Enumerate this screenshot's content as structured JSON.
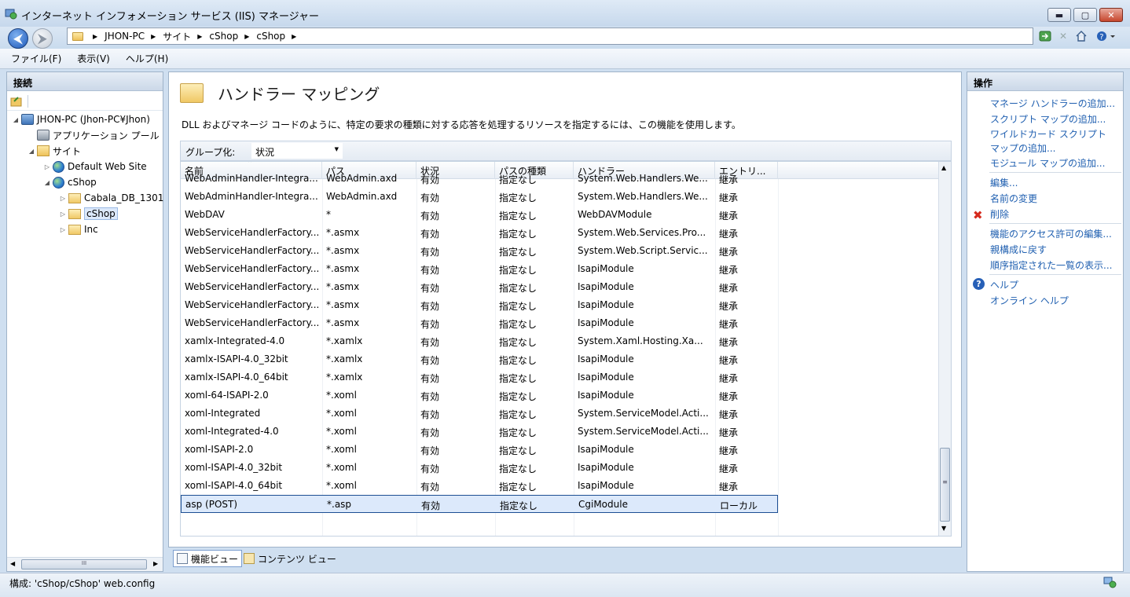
{
  "window": {
    "title": "インターネット インフォメーション サービス (IIS) マネージャー",
    "minimize": "▬",
    "maximize": "▢",
    "close": "✕"
  },
  "address": {
    "breadcrumbs": [
      "JHON-PC",
      "サイト",
      "cShop",
      "cShop"
    ],
    "sep": "▶"
  },
  "menu": [
    "ファイル(F)",
    "表示(V)",
    "ヘルプ(H)"
  ],
  "connections": {
    "title": "接続",
    "tree": [
      {
        "label": "JHON-PC (Jhon-PC¥Jhon)",
        "exp": "◢",
        "icon": "server-icon"
      },
      {
        "label": "アプリケーション プール",
        "exp": "",
        "icon": "app-pool-icon"
      },
      {
        "label": "サイト",
        "exp": "◢",
        "icon": "sites-folder-icon"
      },
      {
        "label": "Default Web Site",
        "exp": "▷",
        "icon": "globe-icon"
      },
      {
        "label": "cShop",
        "exp": "◢",
        "icon": "globe-icon"
      },
      {
        "label": "Cabala_DB_1301",
        "exp": "▷",
        "icon": "folder-icon"
      },
      {
        "label": "cShop",
        "exp": "▷",
        "icon": "folder-icon"
      },
      {
        "label": "Inc",
        "exp": "▷",
        "icon": "folder-icon"
      }
    ],
    "scroll_mark": "III"
  },
  "feature": {
    "title": "ハンドラー マッピング",
    "description": "DLL およびマネージ コードのように、特定の要求の種類に対する応答を処理するリソースを指定するには、この機能を使用します。",
    "group_label": "グループ化:",
    "group_value": "状況"
  },
  "grid": {
    "columns": [
      "名前",
      "パス",
      "状況",
      "パスの種類",
      "ハンドラー",
      "エントリ..."
    ],
    "sort_indicator": "⌃",
    "rows": [
      [
        "WebAdminHandler-Integra...",
        "WebAdmin.axd",
        "有効",
        "指定なし",
        "System.Web.Handlers.We...",
        "継承"
      ],
      [
        "WebAdminHandler-Integra...",
        "WebAdmin.axd",
        "有効",
        "指定なし",
        "System.Web.Handlers.We...",
        "継承"
      ],
      [
        "WebDAV",
        "*",
        "有効",
        "指定なし",
        "WebDAVModule",
        "継承"
      ],
      [
        "WebServiceHandlerFactory...",
        "*.asmx",
        "有効",
        "指定なし",
        "System.Web.Services.Pro...",
        "継承"
      ],
      [
        "WebServiceHandlerFactory...",
        "*.asmx",
        "有効",
        "指定なし",
        "System.Web.Script.Servic...",
        "継承"
      ],
      [
        "WebServiceHandlerFactory...",
        "*.asmx",
        "有効",
        "指定なし",
        "IsapiModule",
        "継承"
      ],
      [
        "WebServiceHandlerFactory...",
        "*.asmx",
        "有効",
        "指定なし",
        "IsapiModule",
        "継承"
      ],
      [
        "WebServiceHandlerFactory...",
        "*.asmx",
        "有効",
        "指定なし",
        "IsapiModule",
        "継承"
      ],
      [
        "WebServiceHandlerFactory...",
        "*.asmx",
        "有効",
        "指定なし",
        "IsapiModule",
        "継承"
      ],
      [
        "xamlx-Integrated-4.0",
        "*.xamlx",
        "有効",
        "指定なし",
        "System.Xaml.Hosting.Xa...",
        "継承"
      ],
      [
        "xamlx-ISAPI-4.0_32bit",
        "*.xamlx",
        "有効",
        "指定なし",
        "IsapiModule",
        "継承"
      ],
      [
        "xamlx-ISAPI-4.0_64bit",
        "*.xamlx",
        "有効",
        "指定なし",
        "IsapiModule",
        "継承"
      ],
      [
        "xoml-64-ISAPI-2.0",
        "*.xoml",
        "有効",
        "指定なし",
        "IsapiModule",
        "継承"
      ],
      [
        "xoml-Integrated",
        "*.xoml",
        "有効",
        "指定なし",
        "System.ServiceModel.Acti...",
        "継承"
      ],
      [
        "xoml-Integrated-4.0",
        "*.xoml",
        "有効",
        "指定なし",
        "System.ServiceModel.Acti...",
        "継承"
      ],
      [
        "xoml-ISAPI-2.0",
        "*.xoml",
        "有効",
        "指定なし",
        "IsapiModule",
        "継承"
      ],
      [
        "xoml-ISAPI-4.0_32bit",
        "*.xoml",
        "有効",
        "指定なし",
        "IsapiModule",
        "継承"
      ],
      [
        "xoml-ISAPI-4.0_64bit",
        "*.xoml",
        "有効",
        "指定なし",
        "IsapiModule",
        "継承"
      ],
      [
        "asp (POST)",
        "*.asp",
        "有効",
        "指定なし",
        "CgiModule",
        "ローカル"
      ]
    ],
    "selected_row": 18,
    "scroll_up": "▲",
    "scroll_down": "▼",
    "scroll_grip": "≡"
  },
  "view_tabs": {
    "features": "機能ビュー",
    "content": "コンテンツ ビュー"
  },
  "actions": {
    "title": "操作",
    "groups": [
      [
        "マネージ ハンドラーの追加...",
        "スクリプト マップの追加...",
        "ワイルドカード スクリプト",
        "マップの追加...",
        "モジュール マップの追加..."
      ],
      [
        "編集...",
        "名前の変更",
        "削除"
      ],
      [
        "機能のアクセス許可の編集...",
        "親構成に戻す",
        "順序指定された一覧の表示..."
      ],
      [
        "ヘルプ",
        "オンライン ヘルプ"
      ]
    ]
  },
  "status": {
    "text": "構成: 'cShop/cShop' web.config"
  },
  "colors": {
    "accent": "#1f5fb0",
    "selection": "#dce9fb",
    "delete": "#d62b1e"
  }
}
